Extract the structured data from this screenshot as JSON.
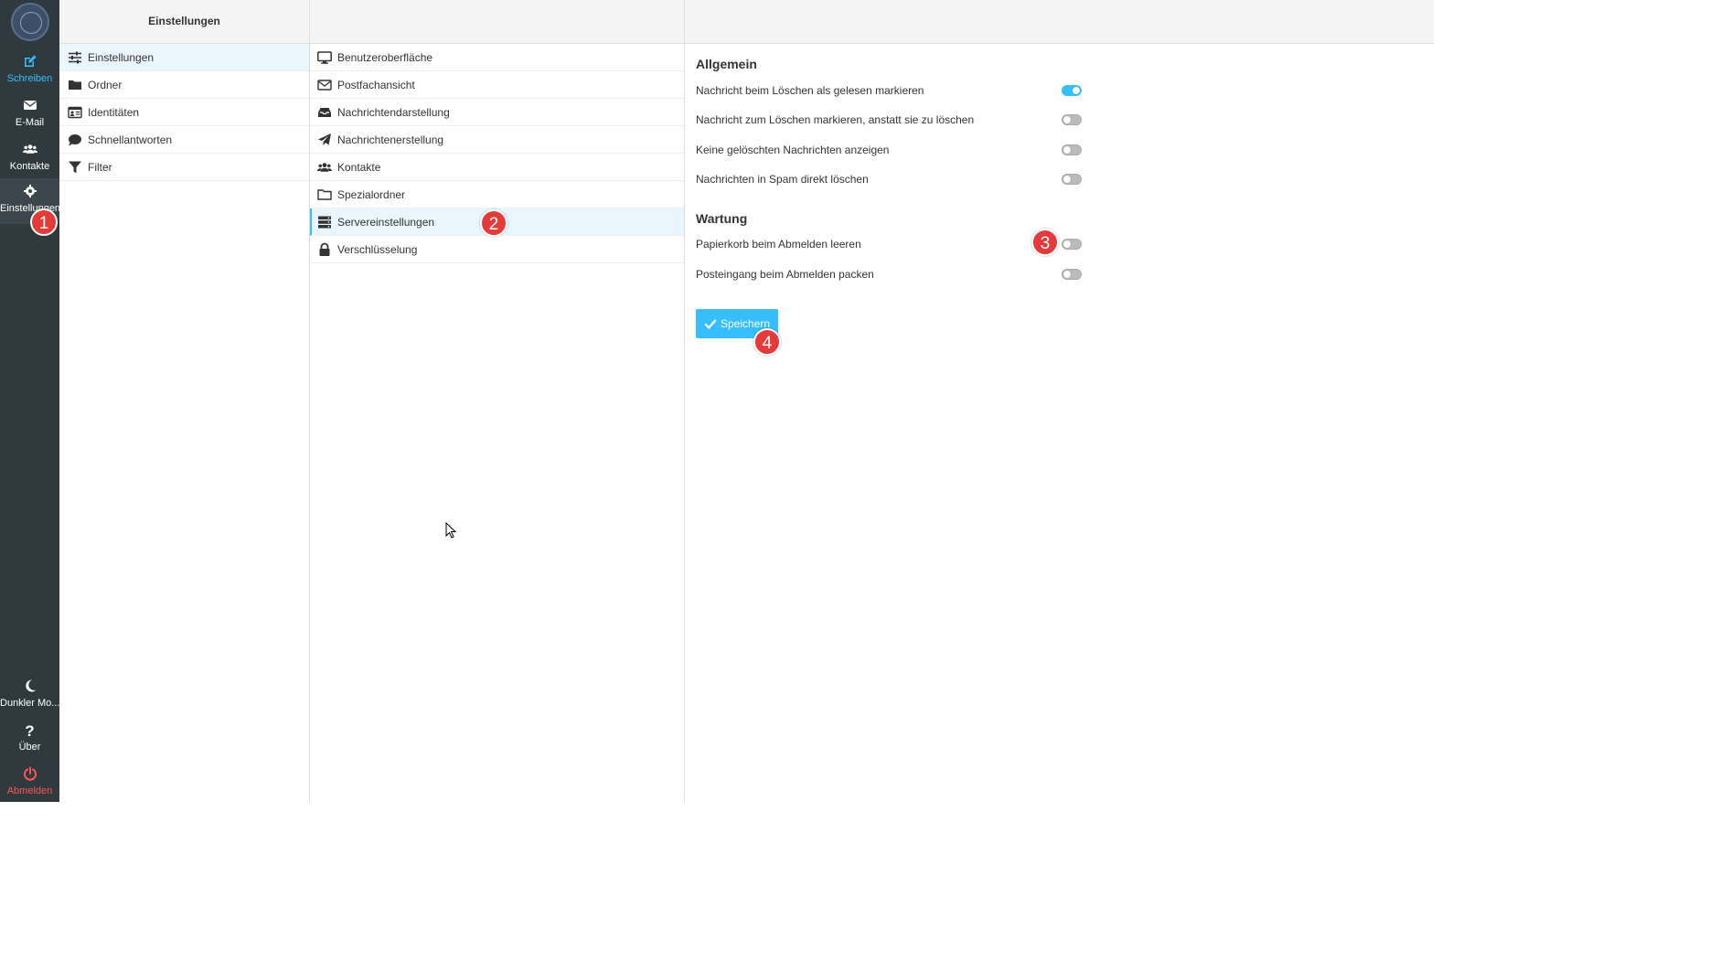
{
  "rail": {
    "items": [
      {
        "label": "Schreiben",
        "icon": "compose-icon"
      },
      {
        "label": "E-Mail",
        "icon": "mail-icon"
      },
      {
        "label": "Kontakte",
        "icon": "contacts-icon"
      },
      {
        "label": "Einstellungen",
        "icon": "gear-icon"
      }
    ],
    "bottom": [
      {
        "label": "Dunkler Mo...",
        "icon": "moon-icon"
      },
      {
        "label": "Über",
        "icon": "question-icon"
      },
      {
        "label": "Abmelden",
        "icon": "power-icon"
      }
    ]
  },
  "col1": {
    "title": "Einstellungen",
    "items": [
      {
        "label": "Einstellungen",
        "icon": "sliders-icon"
      },
      {
        "label": "Ordner",
        "icon": "folder-icon"
      },
      {
        "label": "Identitäten",
        "icon": "id-card-icon"
      },
      {
        "label": "Schnellantworten",
        "icon": "comment-icon"
      },
      {
        "label": "Filter",
        "icon": "filter-icon"
      }
    ]
  },
  "col2": {
    "items": [
      {
        "label": "Benutzeroberfläche",
        "icon": "monitor-icon"
      },
      {
        "label": "Postfachansicht",
        "icon": "envelope-icon"
      },
      {
        "label": "Nachrichtendarstellung",
        "icon": "inbox-icon"
      },
      {
        "label": "Nachrichtenerstellung",
        "icon": "paper-plane-icon"
      },
      {
        "label": "Kontakte",
        "icon": "users-icon"
      },
      {
        "label": "Spezialordner",
        "icon": "folder-outline-icon"
      },
      {
        "label": "Servereinstellungen",
        "icon": "server-icon"
      },
      {
        "label": "Verschlüsselung",
        "icon": "lock-icon"
      }
    ]
  },
  "main": {
    "general_title": "Allgemein",
    "general": [
      {
        "label": "Nachricht beim Löschen als gelesen markieren",
        "enabled": true
      },
      {
        "label": "Nachricht zum Löschen markieren, anstatt sie zu löschen",
        "enabled": false
      },
      {
        "label": "Keine gelöschten Nachrichten anzeigen",
        "enabled": false
      },
      {
        "label": "Nachrichten in Spam direkt löschen",
        "enabled": false
      }
    ],
    "maintenance_title": "Wartung",
    "maintenance": [
      {
        "label": "Papierkorb beim Abmelden leeren",
        "enabled": false
      },
      {
        "label": "Posteingang beim Abmelden packen",
        "enabled": false
      }
    ],
    "save_label": "Speichern"
  },
  "badges": [
    "1",
    "2",
    "3",
    "4"
  ],
  "colors": {
    "accent": "#37beff",
    "rail": "#2f3a3f",
    "badge": "#e53a3a",
    "logout": "#ff5552"
  }
}
